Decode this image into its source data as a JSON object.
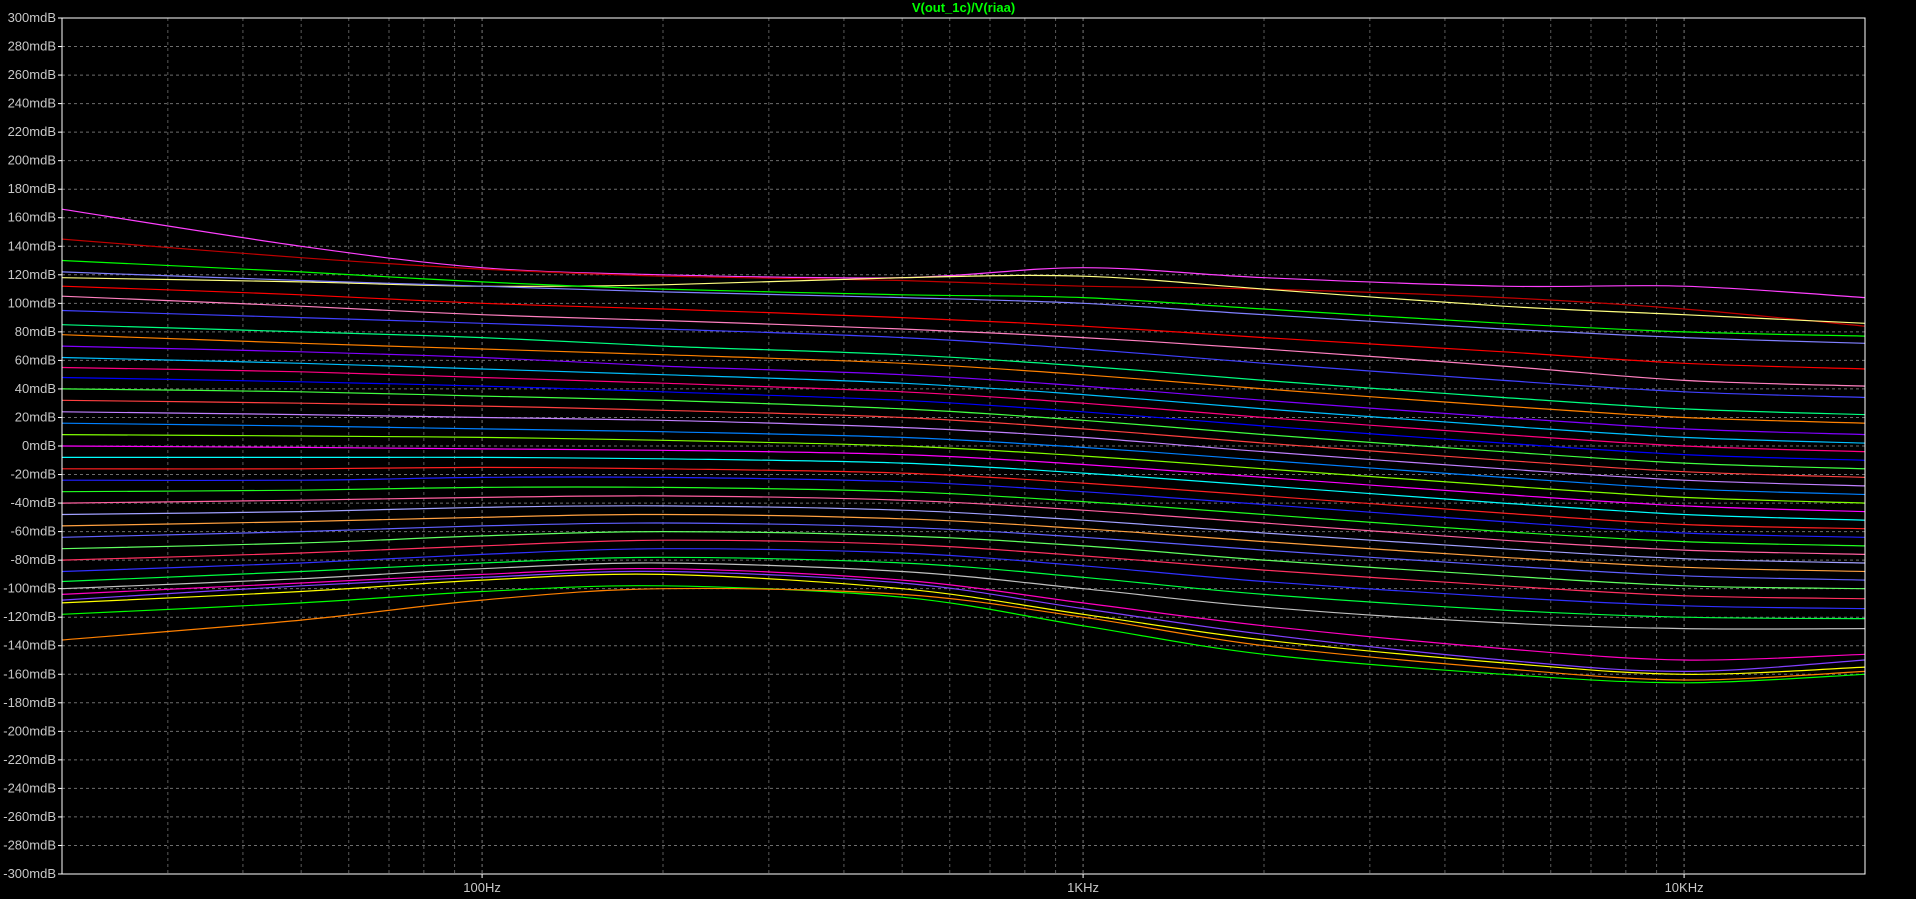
{
  "chart_data": {
    "type": "line",
    "title": "V(out_1c)/V(riaa)",
    "xlabel": "",
    "ylabel": "",
    "x_scale": "log",
    "xlim_hz": [
      20,
      20000
    ],
    "ylim": [
      -300,
      300
    ],
    "y_unit": "mdB",
    "grid": true,
    "legend": "none",
    "y_ticks": [
      {
        "value": 300,
        "label": "300mdB"
      },
      {
        "value": 280,
        "label": "280mdB"
      },
      {
        "value": 260,
        "label": "260mdB"
      },
      {
        "value": 240,
        "label": "240mdB"
      },
      {
        "value": 220,
        "label": "220mdB"
      },
      {
        "value": 200,
        "label": "200mdB"
      },
      {
        "value": 180,
        "label": "180mdB"
      },
      {
        "value": 160,
        "label": "160mdB"
      },
      {
        "value": 140,
        "label": "140mdB"
      },
      {
        "value": 120,
        "label": "120mdB"
      },
      {
        "value": 100,
        "label": "100mdB"
      },
      {
        "value": 80,
        "label": "80mdB"
      },
      {
        "value": 60,
        "label": "60mdB"
      },
      {
        "value": 40,
        "label": "40mdB"
      },
      {
        "value": 20,
        "label": "20mdB"
      },
      {
        "value": 0,
        "label": "0mdB"
      },
      {
        "value": -20,
        "label": "-20mdB"
      },
      {
        "value": -40,
        "label": "-40mdB"
      },
      {
        "value": -60,
        "label": "-60mdB"
      },
      {
        "value": -80,
        "label": "-80mdB"
      },
      {
        "value": -100,
        "label": "-100mdB"
      },
      {
        "value": -120,
        "label": "-120mdB"
      },
      {
        "value": -140,
        "label": "-140mdB"
      },
      {
        "value": -160,
        "label": "-160mdB"
      },
      {
        "value": -180,
        "label": "-180mdB"
      },
      {
        "value": -200,
        "label": "-200mdB"
      },
      {
        "value": -220,
        "label": "-220mdB"
      },
      {
        "value": -240,
        "label": "-240mdB"
      },
      {
        "value": -260,
        "label": "-260mdB"
      },
      {
        "value": -280,
        "label": "-280mdB"
      },
      {
        "value": -300,
        "label": "-300mdB"
      }
    ],
    "x_ticks": [
      {
        "value": 100,
        "label": "100Hz"
      },
      {
        "value": 1000,
        "label": "1KHz"
      },
      {
        "value": 10000,
        "label": "10KHz"
      }
    ],
    "x_minor_grid_hz": [
      30,
      40,
      50,
      60,
      70,
      80,
      90,
      200,
      300,
      400,
      500,
      600,
      700,
      800,
      900,
      2000,
      3000,
      4000,
      5000,
      6000,
      7000,
      8000,
      9000
    ],
    "sample_freqs_hz": [
      20,
      50,
      100,
      200,
      500,
      1000,
      2000,
      5000,
      10000,
      20000
    ],
    "series": [
      {
        "color": "#ff40ff",
        "values": [
          166,
          140,
          125,
          120,
          118,
          125,
          118,
          112,
          112,
          104
        ]
      },
      {
        "color": "#c00000",
        "values": [
          145,
          132,
          124,
          119,
          116,
          112,
          110,
          104,
          96,
          84
        ]
      },
      {
        "color": "#ffff80",
        "values": [
          118,
          115,
          112,
          113,
          118,
          119,
          110,
          98,
          92,
          86
        ]
      },
      {
        "color": "#00ff00",
        "values": [
          130,
          122,
          115,
          110,
          106,
          104,
          96,
          86,
          80,
          77
        ]
      },
      {
        "color": "#8080ff",
        "values": [
          122,
          116,
          112,
          108,
          104,
          100,
          92,
          82,
          76,
          72
        ]
      },
      {
        "color": "#ff0000",
        "values": [
          112,
          106,
          100,
          96,
          90,
          84,
          76,
          66,
          58,
          54
        ]
      },
      {
        "color": "#ff80c0",
        "values": [
          105,
          98,
          92,
          88,
          82,
          76,
          68,
          56,
          46,
          42
        ]
      },
      {
        "color": "#4040ff",
        "values": [
          95,
          90,
          86,
          82,
          76,
          68,
          58,
          46,
          38,
          34
        ]
      },
      {
        "color": "#00ff80",
        "values": [
          85,
          80,
          76,
          70,
          64,
          56,
          46,
          34,
          26,
          22
        ]
      },
      {
        "color": "#ff8000",
        "values": [
          78,
          72,
          68,
          64,
          58,
          50,
          40,
          28,
          20,
          16
        ]
      },
      {
        "color": "#8000ff",
        "values": [
          70,
          66,
          62,
          56,
          50,
          42,
          32,
          20,
          12,
          8
        ]
      },
      {
        "color": "#00c0ff",
        "values": [
          62,
          58,
          54,
          50,
          44,
          36,
          26,
          14,
          6,
          2
        ]
      },
      {
        "color": "#ff0080",
        "values": [
          55,
          52,
          48,
          44,
          38,
          30,
          20,
          8,
          0,
          -4
        ]
      },
      {
        "color": "#0000ff",
        "values": [
          48,
          45,
          42,
          38,
          32,
          24,
          14,
          2,
          -6,
          -10
        ]
      },
      {
        "color": "#40ff40",
        "values": [
          40,
          38,
          35,
          32,
          26,
          18,
          8,
          -4,
          -12,
          -16
        ]
      },
      {
        "color": "#ff4040",
        "values": [
          32,
          30,
          28,
          25,
          20,
          12,
          2,
          -10,
          -18,
          -22
        ]
      },
      {
        "color": "#c080ff",
        "values": [
          24,
          22,
          20,
          18,
          13,
          6,
          -4,
          -16,
          -24,
          -28
        ]
      },
      {
        "color": "#0080ff",
        "values": [
          16,
          14,
          12,
          10,
          6,
          -1,
          -10,
          -22,
          -30,
          -34
        ]
      },
      {
        "color": "#80ff00",
        "values": [
          8,
          7,
          6,
          4,
          0,
          -7,
          -16,
          -28,
          -36,
          -40
        ]
      },
      {
        "color": "#ff00ff",
        "values": [
          0,
          -1,
          -2,
          -3,
          -6,
          -13,
          -22,
          -34,
          -42,
          -46
        ]
      },
      {
        "color": "#00ffff",
        "values": [
          -8,
          -8,
          -8,
          -9,
          -12,
          -19,
          -28,
          -40,
          -48,
          -52
        ]
      },
      {
        "color": "#ff2020",
        "values": [
          -16,
          -16,
          -15,
          -16,
          -19,
          -26,
          -35,
          -47,
          -55,
          -58
        ]
      },
      {
        "color": "#2020ff",
        "values": [
          -24,
          -24,
          -22,
          -22,
          -25,
          -32,
          -41,
          -53,
          -61,
          -64
        ]
      },
      {
        "color": "#20ff20",
        "values": [
          -32,
          -31,
          -29,
          -29,
          -32,
          -39,
          -48,
          -60,
          -67,
          -70
        ]
      },
      {
        "color": "#ff60a0",
        "values": [
          -40,
          -38,
          -36,
          -35,
          -38,
          -45,
          -54,
          -66,
          -73,
          -76
        ]
      },
      {
        "color": "#a0a0ff",
        "values": [
          -48,
          -46,
          -43,
          -42,
          -45,
          -52,
          -61,
          -72,
          -79,
          -82
        ]
      },
      {
        "color": "#ffa040",
        "values": [
          -56,
          -53,
          -50,
          -48,
          -51,
          -58,
          -67,
          -78,
          -85,
          -88
        ]
      },
      {
        "color": "#6060ff",
        "values": [
          -64,
          -60,
          -56,
          -54,
          -57,
          -64,
          -73,
          -84,
          -91,
          -94
        ]
      },
      {
        "color": "#60ff60",
        "values": [
          -72,
          -68,
          -63,
          -60,
          -63,
          -70,
          -80,
          -91,
          -98,
          -100
        ]
      },
      {
        "color": "#ff3060",
        "values": [
          -80,
          -75,
          -70,
          -66,
          -69,
          -77,
          -87,
          -98,
          -105,
          -107
        ]
      },
      {
        "color": "#3030ff",
        "values": [
          -88,
          -82,
          -76,
          -72,
          -75,
          -84,
          -95,
          -106,
          -112,
          -114
        ]
      },
      {
        "color": "#00ff40",
        "values": [
          -95,
          -88,
          -82,
          -78,
          -82,
          -92,
          -104,
          -115,
          -120,
          -121
        ]
      },
      {
        "color": "#c0c0c0",
        "values": [
          -100,
          -93,
          -86,
          -82,
          -88,
          -100,
          -113,
          -124,
          -128,
          -128
        ]
      },
      {
        "color": "#ff00c0",
        "values": [
          -104,
          -96,
          -90,
          -86,
          -94,
          -110,
          -126,
          -142,
          -150,
          -146
        ]
      },
      {
        "color": "#ffff00",
        "values": [
          -110,
          -102,
          -94,
          -90,
          -100,
          -118,
          -136,
          -152,
          -160,
          -155
        ]
      },
      {
        "color": "#00ff00",
        "values": [
          -118,
          -110,
          -102,
          -98,
          -106,
          -126,
          -146,
          -160,
          -166,
          -160
        ]
      },
      {
        "color": "#ff8000",
        "values": [
          -136,
          -122,
          -108,
          -100,
          -104,
          -120,
          -140,
          -156,
          -164,
          -158
        ]
      },
      {
        "color": "#8040ff",
        "values": [
          -108,
          -98,
          -92,
          -88,
          -96,
          -114,
          -132,
          -150,
          -158,
          -150
        ]
      }
    ]
  }
}
